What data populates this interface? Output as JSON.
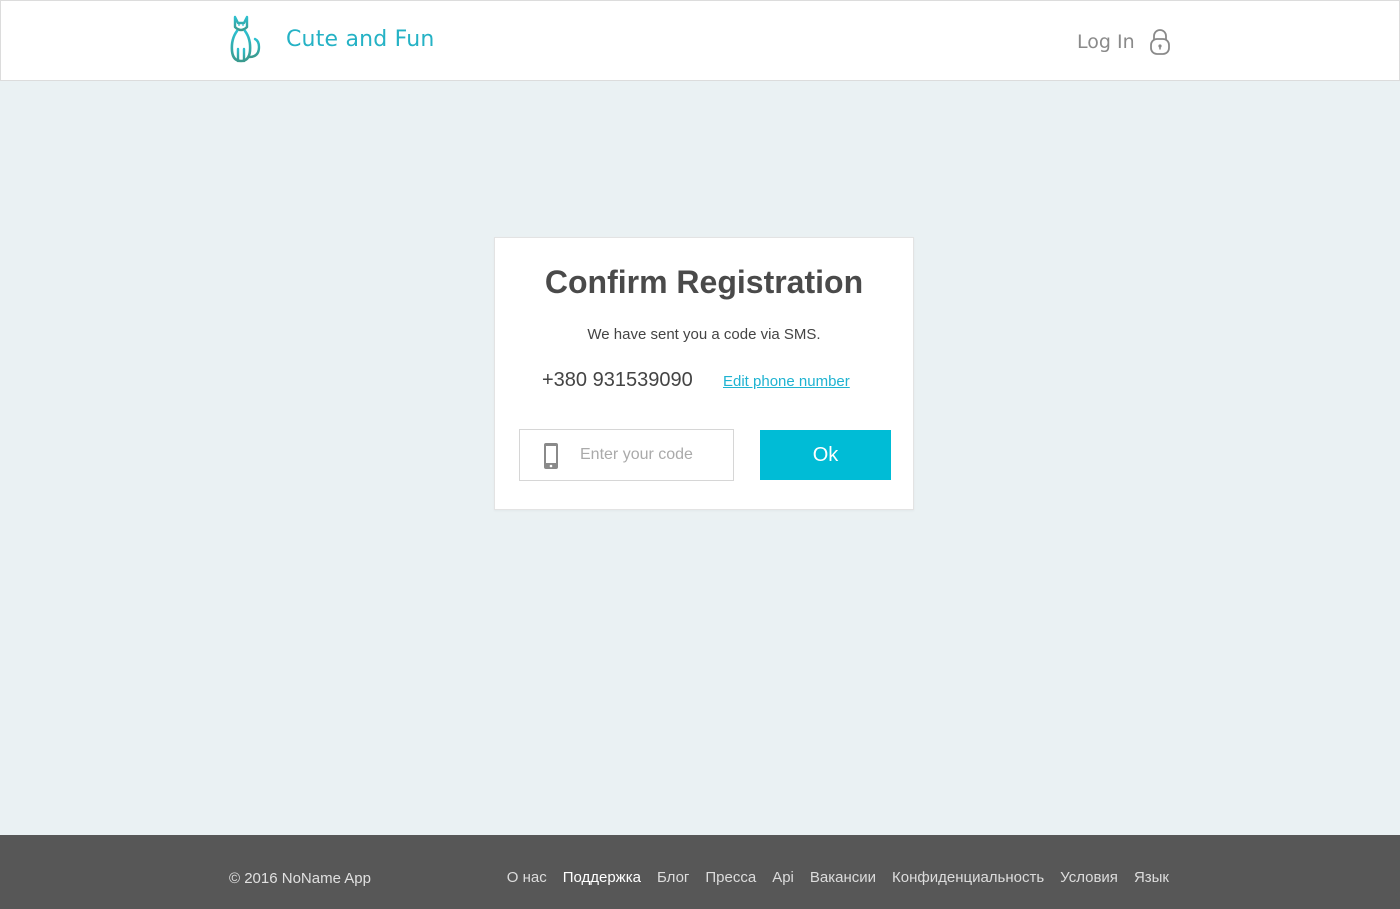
{
  "header": {
    "brand": "Cute and Fun",
    "login_label": "Log In",
    "logo_icon": "cat-logo-icon",
    "login_icon": "lock-icon",
    "accent_color": "#25b2c5"
  },
  "card": {
    "title": "Confirm Registration",
    "subtitle": "We have sent you a code via SMS.",
    "phone_number": "+380 931539090",
    "edit_link": "Edit phone number",
    "code_placeholder": "Enter your code",
    "code_value": "",
    "field_icon": "mobile-phone-icon",
    "ok_label": "Ok",
    "button_color": "#00bcd6"
  },
  "footer": {
    "copyright": "© 2016 NoName App",
    "links": [
      {
        "label": "О нас"
      },
      {
        "label": "Поддержка",
        "active": true
      },
      {
        "label": "Блог"
      },
      {
        "label": "Пресса"
      },
      {
        "label": "Api"
      },
      {
        "label": "Вакансии"
      },
      {
        "label": "Конфиденциальность"
      },
      {
        "label": "Условия"
      },
      {
        "label": "Язык"
      }
    ],
    "background_color": "#575757"
  }
}
